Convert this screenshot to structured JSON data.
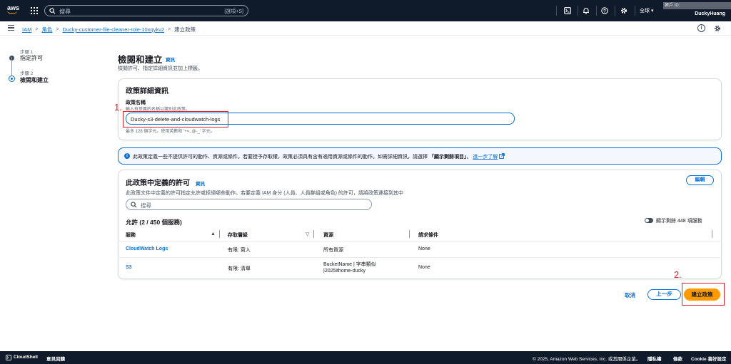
{
  "topnav": {
    "logo": "aws",
    "search_placeholder": "搜尋",
    "search_shortcut": "[選項+S]",
    "icons": [
      "cloudshell-icon",
      "bell-icon",
      "help-icon",
      "gear-icon"
    ],
    "region": "全球 ▾",
    "account_id_label": "帳戶 ID: ",
    "user": "DuckyHuang"
  },
  "breadcrumb": {
    "items": [
      "IAM",
      "角色",
      "Ducky-customer-file-cleaner-role-10xqykv2"
    ],
    "current": "建立政策"
  },
  "steps": [
    {
      "step": "步驟 1",
      "label": "指定許可",
      "active": false
    },
    {
      "step": "步驟 2",
      "label": "檢閱和建立",
      "active": true
    }
  ],
  "page": {
    "title": "檢閱和建立",
    "info": "資訊",
    "description": "檢閱許可、指定詳細資訊並加上標籤。"
  },
  "policy_details": {
    "title": "政策詳細資訊",
    "name_label": "政策名稱",
    "name_desc": "輸入有意義的名稱以識別此政策。",
    "name_value": "Ducky-s3-delete-and-cloudwatch-logs",
    "name_help": "最多 128 個字元。使用英數和 '+=,.@-_' 字元。"
  },
  "annotations": {
    "one": "1.",
    "two": "2."
  },
  "alert": {
    "text": "此政策定義一些不提供許可的動作、資源或條件。若要授予存取權，政策必須具有含有適用資源或條件的動作。如需詳細資訊，請選擇",
    "bold": "「顯示剩餘項目」",
    "suffix": "。",
    "link": "進一步了解"
  },
  "permissions": {
    "title": "此政策中定義的許可",
    "info": "資訊",
    "edit": "編輯",
    "description": "此政策文件中定義的許可指定允許或拒絕哪些動作。若要定義 IAM 身分 (人員、人員群組或角色) 的許可，請將政策連接到其中",
    "search_placeholder": "搜尋",
    "allow_title": "允許 (2 / 450 個服務)",
    "toggle_label": "顯示剩餘 448 項服務",
    "columns": [
      "服務",
      "存取層級",
      "資源",
      "請求條件"
    ],
    "rows": [
      {
        "service": "CloudWatch Logs",
        "access": "有限: 寫入",
        "resource": "所有資源",
        "condition": "None"
      },
      {
        "service": "S3",
        "access": "有限: 清單",
        "resource_line1": "BucketName | 字串類似",
        "resource_line2": "|2025ithome-ducky",
        "condition": "None"
      }
    ]
  },
  "actions": {
    "cancel": "取消",
    "previous": "上一步",
    "create": "建立政策"
  },
  "footer": {
    "cloudshell": "CloudShell",
    "feedback": "意見回饋",
    "copyright": "© 2025, Amazon Web Services, Inc. 或其關係企業。",
    "privacy": "隱私權",
    "terms": "條款",
    "cookies": "Cookie 喜好設定"
  }
}
